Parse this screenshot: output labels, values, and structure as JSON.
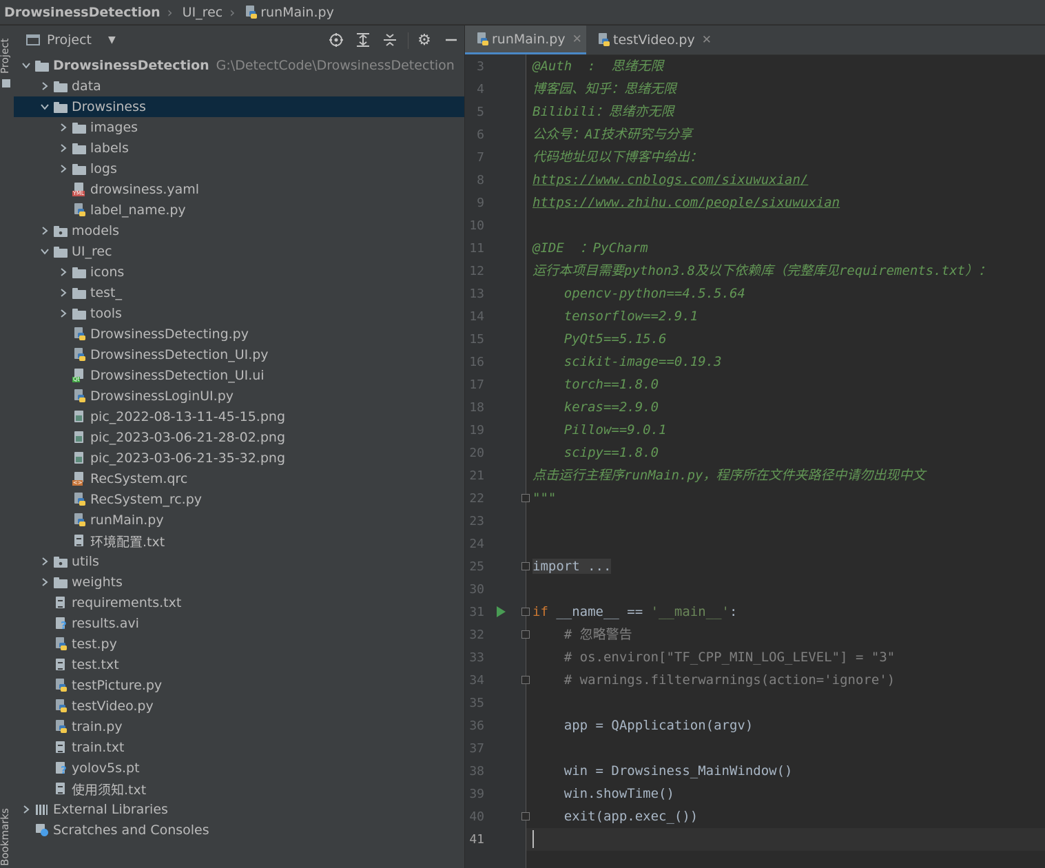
{
  "breadcrumb": {
    "project": "DrowsinessDetection",
    "folder": "UI_rec",
    "file": "runMain.py"
  },
  "sidebar": {
    "project_tab": "Project",
    "bookmarks_tab": "Bookmarks"
  },
  "project_panel": {
    "title": "Project",
    "tree": [
      {
        "name": "DrowsinessDetection",
        "path": "G:\\DetectCode\\DrowsinessDetection",
        "icon": "folder-icon",
        "level": 0,
        "expanded": true
      },
      {
        "name": "data",
        "icon": "folder-icon",
        "level": 1,
        "expanded": false
      },
      {
        "name": "Drowsiness",
        "icon": "folder-icon",
        "level": 1,
        "expanded": true,
        "selected": true
      },
      {
        "name": "images",
        "icon": "folder-icon",
        "level": 2,
        "expanded": false
      },
      {
        "name": "labels",
        "icon": "folder-icon",
        "level": 2,
        "expanded": false
      },
      {
        "name": "logs",
        "icon": "folder-icon",
        "level": 2,
        "expanded": false
      },
      {
        "name": "drowsiness.yaml",
        "icon": "yaml-file-icon",
        "level": 2
      },
      {
        "name": "label_name.py",
        "icon": "python-file-icon",
        "level": 2
      },
      {
        "name": "models",
        "icon": "package-folder-icon",
        "level": 1,
        "expanded": false
      },
      {
        "name": "UI_rec",
        "icon": "folder-icon",
        "level": 1,
        "expanded": true
      },
      {
        "name": "icons",
        "icon": "folder-icon",
        "level": 2,
        "expanded": false
      },
      {
        "name": "test_",
        "icon": "folder-icon",
        "level": 2,
        "expanded": false
      },
      {
        "name": "tools",
        "icon": "folder-icon",
        "level": 2,
        "expanded": false
      },
      {
        "name": "DrowsinessDetecting.py",
        "icon": "python-file-icon",
        "level": 2
      },
      {
        "name": "DrowsinessDetection_UI.py",
        "icon": "python-file-icon",
        "level": 2
      },
      {
        "name": "DrowsinessDetection_UI.ui",
        "icon": "qt-ui-file-icon",
        "level": 2
      },
      {
        "name": "DrowsinessLoginUI.py",
        "icon": "python-file-icon",
        "level": 2
      },
      {
        "name": "pic_2022-08-13-11-45-15.png",
        "icon": "image-file-icon",
        "level": 2
      },
      {
        "name": "pic_2023-03-06-21-28-02.png",
        "icon": "image-file-icon",
        "level": 2
      },
      {
        "name": "pic_2023-03-06-21-35-32.png",
        "icon": "image-file-icon",
        "level": 2
      },
      {
        "name": "RecSystem.qrc",
        "icon": "qrc-file-icon",
        "level": 2
      },
      {
        "name": "RecSystem_rc.py",
        "icon": "python-file-icon",
        "level": 2
      },
      {
        "name": "runMain.py",
        "icon": "python-file-icon",
        "level": 2
      },
      {
        "name": "环境配置.txt",
        "icon": "text-file-icon",
        "level": 2
      },
      {
        "name": "utils",
        "icon": "package-folder-icon",
        "level": 1,
        "expanded": false
      },
      {
        "name": "weights",
        "icon": "folder-icon",
        "level": 1,
        "expanded": false
      },
      {
        "name": "requirements.txt",
        "icon": "text-file-icon",
        "level": 1
      },
      {
        "name": "results.avi",
        "icon": "unknown-file-icon",
        "level": 1
      },
      {
        "name": "test.py",
        "icon": "python-file-icon",
        "level": 1
      },
      {
        "name": "test.txt",
        "icon": "text-file-icon",
        "level": 1
      },
      {
        "name": "testPicture.py",
        "icon": "python-file-icon",
        "level": 1
      },
      {
        "name": "testVideo.py",
        "icon": "python-file-icon",
        "level": 1
      },
      {
        "name": "train.py",
        "icon": "python-file-icon",
        "level": 1
      },
      {
        "name": "train.txt",
        "icon": "text-file-icon",
        "level": 1
      },
      {
        "name": "yolov5s.pt",
        "icon": "unknown-file-icon",
        "level": 1
      },
      {
        "name": "使用须知.txt",
        "icon": "text-file-icon",
        "level": 1
      },
      {
        "name": "External Libraries",
        "icon": "libraries-icon",
        "level": 0,
        "expanded": false
      },
      {
        "name": "Scratches and Consoles",
        "icon": "scratches-icon",
        "level": 0
      }
    ]
  },
  "editor": {
    "tabs": [
      {
        "label": "runMain.py",
        "active": true
      },
      {
        "label": "testVideo.py",
        "active": false
      }
    ],
    "lines": [
      {
        "num": "3",
        "text": "@Auth  :  思绪无限",
        "style": "doc"
      },
      {
        "num": "4",
        "text": "博客园、知乎：思绪无限",
        "style": "doc"
      },
      {
        "num": "5",
        "text": "Bilibili：思绪亦无限",
        "style": "doc"
      },
      {
        "num": "6",
        "text": "公众号：AI技术研究与分享",
        "style": "doc"
      },
      {
        "num": "7",
        "text": "代码地址见以下博客中给出：",
        "style": "doc"
      },
      {
        "num": "8",
        "text": "https://www.cnblogs.com/sixuwuxian/",
        "style": "url"
      },
      {
        "num": "9",
        "text": "https://www.zhihu.com/people/sixuwuxian",
        "style": "url"
      },
      {
        "num": "10",
        "text": "",
        "style": "doc"
      },
      {
        "num": "11",
        "text": "@IDE  ：PyCharm",
        "style": "doc"
      },
      {
        "num": "12",
        "text": "运行本项目需要python3.8及以下依赖库（完整库见requirements.txt）：",
        "style": "doc"
      },
      {
        "num": "13",
        "text": "    opencv-python==4.5.5.64",
        "style": "doc"
      },
      {
        "num": "14",
        "text": "    tensorflow==2.9.1",
        "style": "doc"
      },
      {
        "num": "15",
        "text": "    PyQt5==5.15.6",
        "style": "doc"
      },
      {
        "num": "16",
        "text": "    scikit-image==0.19.3",
        "style": "doc"
      },
      {
        "num": "17",
        "text": "    torch==1.8.0",
        "style": "doc"
      },
      {
        "num": "18",
        "text": "    keras==2.9.0",
        "style": "doc"
      },
      {
        "num": "19",
        "text": "    Pillow==9.0.1",
        "style": "doc"
      },
      {
        "num": "20",
        "text": "    scipy==1.8.0",
        "style": "doc"
      },
      {
        "num": "21",
        "text": "点击运行主程序runMain.py，程序所在文件夹路径中请勿出现中文",
        "style": "doc"
      },
      {
        "num": "22",
        "text": "\"\"\"",
        "style": "doc"
      },
      {
        "num": "23",
        "text": "",
        "style": "plain"
      },
      {
        "num": "24",
        "text": "",
        "style": "plain"
      },
      {
        "num": "25",
        "text": "import ...",
        "style": "fold"
      },
      {
        "num": "30",
        "text": "",
        "style": "plain"
      },
      {
        "num": "31",
        "text": "",
        "style": "ifmain"
      },
      {
        "num": "32",
        "text": "    # 忽略警告",
        "style": "comment"
      },
      {
        "num": "33",
        "text": "    # os.environ[\"TF_CPP_MIN_LOG_LEVEL\"] = \"3\"",
        "style": "comment"
      },
      {
        "num": "34",
        "text": "    # warnings.filterwarnings(action='ignore')",
        "style": "comment"
      },
      {
        "num": "35",
        "text": "",
        "style": "plain"
      },
      {
        "num": "36",
        "text": "    app = QApplication(argv)",
        "style": "plain"
      },
      {
        "num": "37",
        "text": "",
        "style": "plain"
      },
      {
        "num": "38",
        "text": "    win = Drowsiness_MainWindow()",
        "style": "plain"
      },
      {
        "num": "39",
        "text": "    win.showTime()",
        "style": "plain"
      },
      {
        "num": "40",
        "text": "    exit(app.exec_())",
        "style": "plain"
      },
      {
        "num": "41",
        "text": "",
        "style": "current"
      }
    ],
    "ifmain": {
      "kw": "if",
      "mid": " __name__ == ",
      "str": "'__main__'",
      "end": ":"
    }
  },
  "colors": {
    "panel_bg": "#3c3f41",
    "editor_bg": "#2b2b2b",
    "selection": "#0d293e",
    "docstring": "#629755",
    "keyword": "#cc7832",
    "string": "#6a8759",
    "comment": "#808080",
    "run_arrow": "#499c54"
  }
}
